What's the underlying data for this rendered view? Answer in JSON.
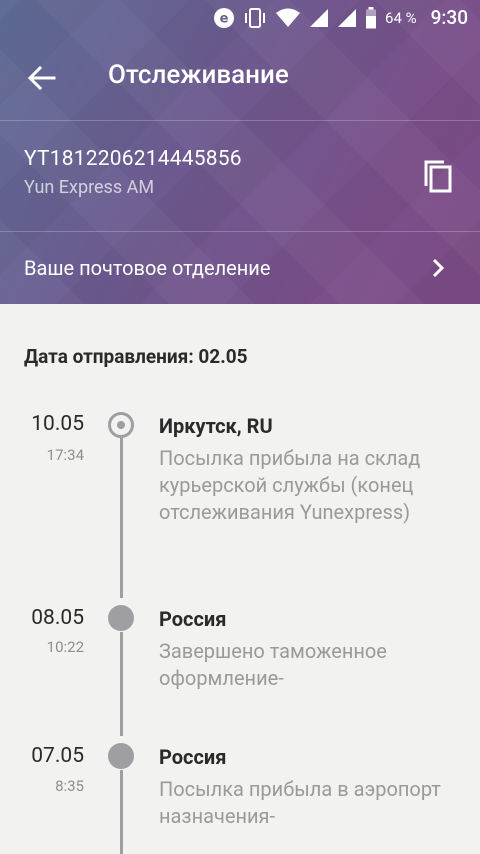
{
  "status_bar": {
    "battery_percent": "64 %",
    "time": "9:30",
    "icons": [
      "e-badge-icon",
      "vibrate-icon",
      "wifi-icon",
      "signal-icon",
      "signal-icon",
      "battery-icon"
    ]
  },
  "appbar": {
    "title": "Отслеживание",
    "back_icon": "arrow-back-icon"
  },
  "parcel": {
    "tracking_number": "YT1812206214445856",
    "carrier": "Yun Express AM",
    "copy_icon": "copy-icon"
  },
  "post_office": {
    "label": "Ваше почтовое отделение",
    "chevron_icon": "chevron-right-icon"
  },
  "ship_date": "Дата отправления: 02.05",
  "events": [
    {
      "date": "10.05",
      "time": "17:34",
      "place": "Иркутск, RU",
      "description": "Посылка прибыла на склад курьерской службы (конец отслеживания Yunexpress)",
      "current": true
    },
    {
      "date": "08.05",
      "time": "10:22",
      "place": "Россия",
      "description": "Завершено таможенное оформление-",
      "current": false
    },
    {
      "date": "07.05",
      "time": "8:35",
      "place": "Россия",
      "description": "Посылка прибыла в аэропорт назначения-",
      "current": false
    }
  ],
  "colors": {
    "header_start": "#5e6d97",
    "header_end": "#7c4a84",
    "timeline": "#9e9ea3",
    "background": "#f2f2f0"
  }
}
